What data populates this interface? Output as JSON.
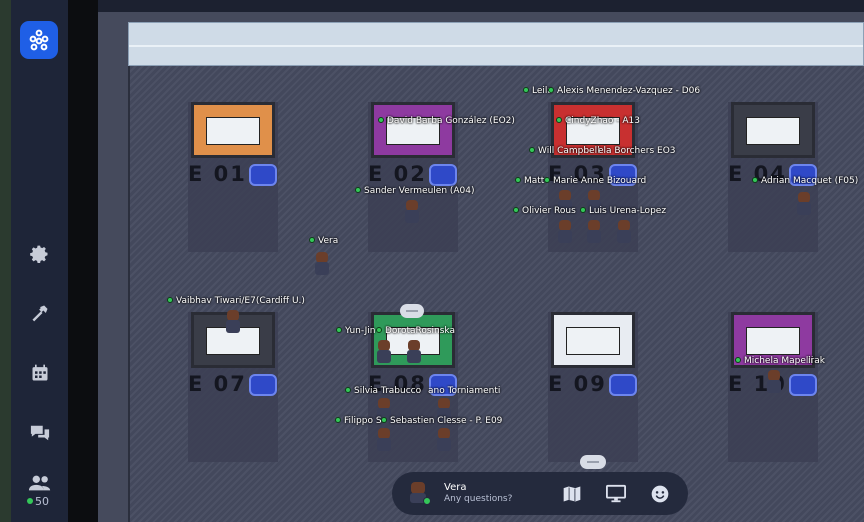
{
  "nav": {
    "participant_count": "50"
  },
  "booths": [
    {
      "label": "E 01",
      "color": "#e0904a"
    },
    {
      "label": "E 02",
      "color": "#8e3aa0"
    },
    {
      "label": "E 03",
      "color": "#c83030"
    },
    {
      "label": "E 04",
      "color": "#3a3d48"
    },
    {
      "label": "E 07",
      "color": "#3a3d48"
    },
    {
      "label": "E 08",
      "color": "#2f9a5a"
    },
    {
      "label": "E 09",
      "color": "#e8ecf2"
    },
    {
      "label": "E 10",
      "color": "#8e3aa0"
    }
  ],
  "names": [
    "Leila",
    "Alexis Menendez-Vazquez - D06",
    "David Barba González (EO2)",
    "CindyZhao - A13",
    "Will Campbell",
    "ela Borchers EO3",
    "Matt",
    "Marie Anne Bizouard",
    "Adrian Macquet (F05)",
    "Sander Vermeulen (A04)",
    "Olivier Rous",
    "Luis Urena-Lopez",
    "Vera",
    "Vaibhav Tiwari/E7(Cardiff U.)",
    "Yun-Jin",
    "DorotaRosinska",
    "Michela Mapelli",
    "irak",
    "Silvia Trabucco",
    "ano Torniamenti",
    "Filippo S",
    "Sebastien Clesse - P. E09"
  ],
  "bottom_bar": {
    "user_name": "Vera",
    "status": "Any questions?",
    "icons": [
      "map-icon",
      "screen-share-icon",
      "emoji-icon"
    ]
  }
}
